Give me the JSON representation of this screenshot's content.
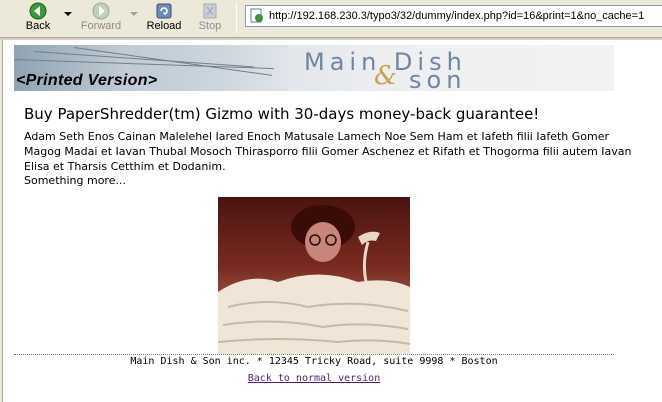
{
  "toolbar": {
    "back_label": "Back",
    "forward_label": "Forward",
    "reload_label": "Reload",
    "stop_label": "Stop"
  },
  "address": {
    "url": "http://192.168.230.3/typo3/32/dummy/index.php?id=16&print=1&no_cache=1"
  },
  "banner": {
    "printed_label": "<Printed Version>",
    "brand_line1": "Main Dish",
    "brand_amp": "&",
    "brand_line2": "son"
  },
  "article": {
    "headline": "Buy PaperShredder(tm) Gizmo with 30-days money-back guarantee!",
    "body": "Adam Seth Enos Cainan Malelehel Iared Enoch Matusale Lamech Noe Sem Ham et Iafeth filii Iafeth Gomer Magog Madai et Iavan Thubal Mosoch Thirasporro filii Gomer Aschenez et Rifath et Thogorma filii autem Iavan Elisa et Tharsis Cetthim et Dodanim.",
    "more": "Something more..."
  },
  "footer": {
    "address": "Main Dish & Son inc. * 12345 Tricky Road, suite 9998 * Boston",
    "back_link": "Back to normal version"
  },
  "colors": {
    "link_visited": "#551a8b",
    "toolbar_bg": "#ece9d8",
    "brand_blue": "#6f86a3"
  }
}
